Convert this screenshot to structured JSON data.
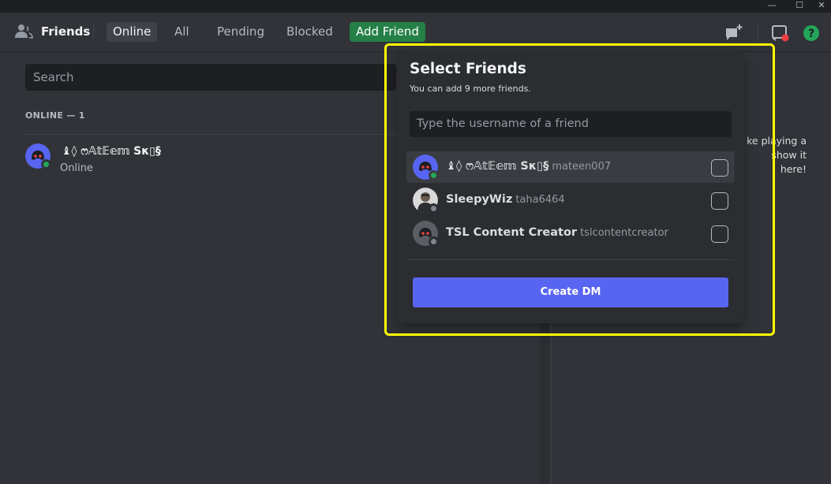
{
  "window": {
    "minimize_glyph": "—",
    "maximize_glyph": "☐",
    "close_glyph": "✕"
  },
  "header": {
    "title": "Friends",
    "title_icon": "friends-wave-icon",
    "tabs": [
      {
        "label": "Online",
        "active": true
      },
      {
        "label": "All",
        "active": false
      },
      {
        "label": "Pending",
        "active": false
      },
      {
        "label": "Blocked",
        "active": false
      }
    ],
    "add_friend_label": "Add Friend",
    "icons": [
      "new-group-dm-icon",
      "inbox-icon",
      "help-icon"
    ],
    "help_glyph": "?"
  },
  "main": {
    "search_placeholder": "Search",
    "online_label": "ONLINE — 1",
    "friends": [
      {
        "name": "♝◊ ෆ𝔸𝕥𝔼𝕖𝕞 Sκ▯§",
        "status": "Online"
      }
    ]
  },
  "active_now": {
    "partial_text_line1": "ke playing a",
    "partial_text_line2": "show it here!"
  },
  "popup": {
    "title": "Select Friends",
    "subtitle": "You can add 9 more friends.",
    "input_placeholder": "Type the username of a friend",
    "friends": [
      {
        "display_name": "♝◊ ෆ𝔸𝕥𝔼𝕖𝕞 Sκ▯§",
        "username": "mateen007",
        "status": "online"
      },
      {
        "display_name": "SleepyWiz",
        "username": "taha6464",
        "status": "offline"
      },
      {
        "display_name": "TSL Content Creator",
        "username": "tslcontentcreator",
        "status": "offline"
      }
    ],
    "create_button": "Create DM"
  },
  "colors": {
    "accent": "#5865f2",
    "online": "#23a55a",
    "add_friend_bg": "#248046",
    "highlight": "#ffff00"
  }
}
